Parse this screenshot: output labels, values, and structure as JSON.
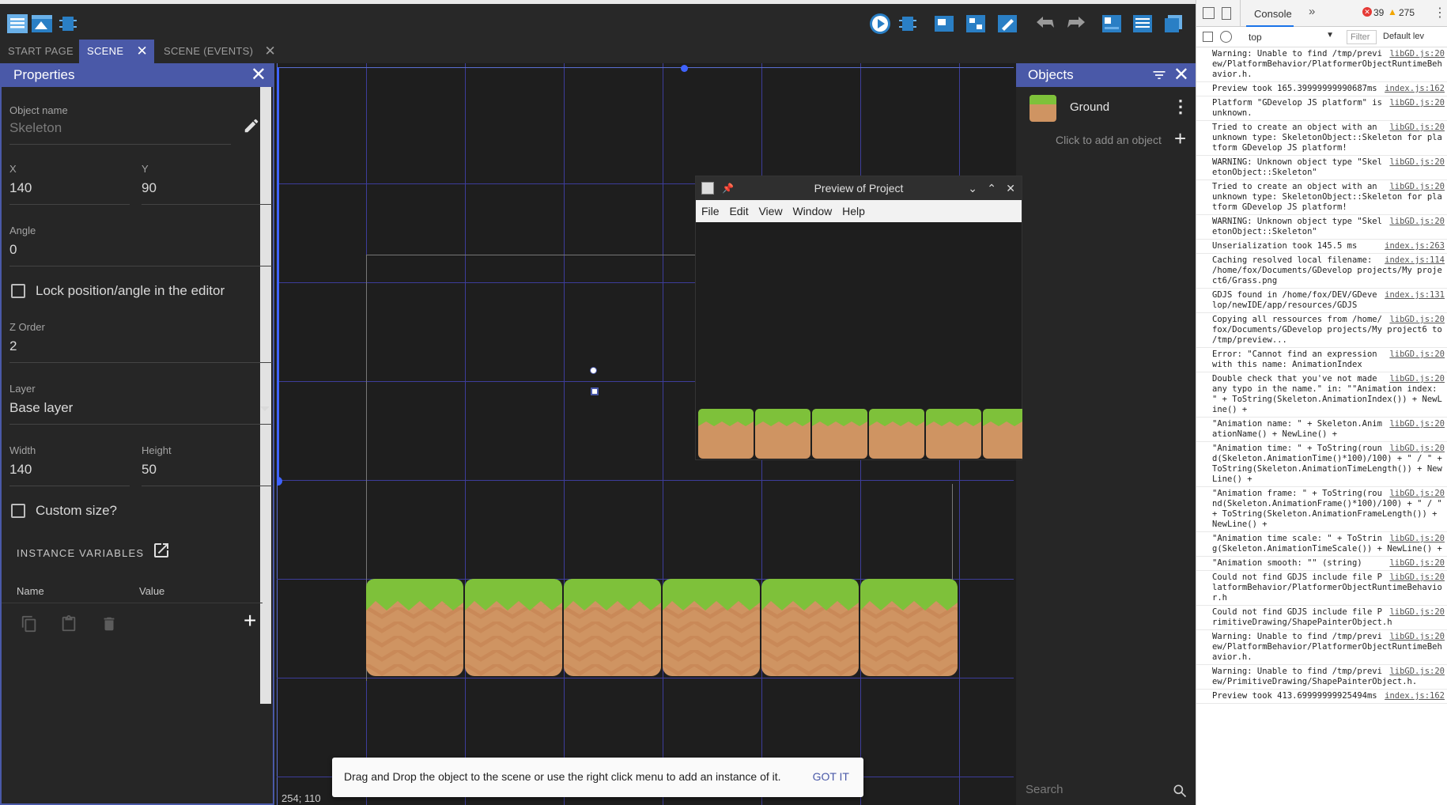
{
  "tabs": [
    {
      "label": "START PAGE"
    },
    {
      "label": "SCENE"
    },
    {
      "label": "SCENE (EVENTS)"
    }
  ],
  "properties": {
    "title": "Properties",
    "object_name_label": "Object name",
    "object_name_value": "Skeleton",
    "x_label": "X",
    "x_value": "140",
    "y_label": "Y",
    "y_value": "90",
    "angle_label": "Angle",
    "angle_value": "0",
    "lock_label": "Lock position/angle in the editor",
    "zorder_label": "Z Order",
    "zorder_value": "2",
    "layer_label": "Layer",
    "layer_value": "Base layer",
    "width_label": "Width",
    "width_value": "140",
    "height_label": "Height",
    "height_value": "50",
    "custom_size_label": "Custom size?",
    "instance_variables_label": "INSTANCE VARIABLES",
    "col_name": "Name",
    "col_value": "Value"
  },
  "scene": {
    "coordinates": "254; 110"
  },
  "objects": {
    "title": "Objects",
    "items": [
      {
        "name": "Ground"
      }
    ],
    "add_object_label": "Click to add an object",
    "search_placeholder": "Search"
  },
  "preview": {
    "title": "Preview of Project",
    "menu": [
      "File",
      "Edit",
      "View",
      "Window",
      "Help"
    ]
  },
  "snackbar": {
    "message": "Drag and Drop the object to the scene or use the right click menu to add an instance of it.",
    "action": "GOT IT"
  },
  "console": {
    "tab_label": "Console",
    "error_count": "39",
    "warning_count": "275",
    "context": "top",
    "filter_placeholder": "Filter",
    "levels_label": "Default lev",
    "entries": [
      {
        "text": "Warning: Unable to find /tmp/preview/PlatformBehavior/PlatformerObjectRuntimeBehavior.h.",
        "src": "libGD.js:20"
      },
      {
        "text": "Preview took 165.39999999990687ms",
        "src": "index.js:162"
      },
      {
        "text": "Platform \"GDevelop JS platform\" is unknown.",
        "src": "libGD.js:20"
      },
      {
        "text": "Tried to create an object with an unknown type: SkeletonObject::Skeleton for platform GDevelop JS platform!",
        "src": "libGD.js:20"
      },
      {
        "text": "WARNING: Unknown object type \"SkeletonObject::Skeleton\"",
        "src": "libGD.js:20"
      },
      {
        "text": "Tried to create an object with an unknown type: SkeletonObject::Skeleton for platform GDevelop JS platform!",
        "src": "libGD.js:20"
      },
      {
        "text": "WARNING: Unknown object type \"SkeletonObject::Skeleton\"",
        "src": "libGD.js:20"
      },
      {
        "text": "Unserialization took 145.5 ms",
        "src": "index.js:263"
      },
      {
        "text": "Caching resolved local filename: /home/fox/Documents/GDevelop projects/My project6/Grass.png",
        "src": "index.js:114"
      },
      {
        "text": "GDJS found in /home/fox/DEV/GDevelop/newIDE/app/resources/GDJS",
        "src": "index.js:131"
      },
      {
        "text": "Copying all ressources from /home/fox/Documents/GDevelop projects/My project6 to /tmp/preview...",
        "src": "libGD.js:20"
      },
      {
        "text": "Error: \"Cannot find an expression with this name: AnimationIndex",
        "src": "libGD.js:20"
      },
      {
        "text": "Double check that you've not made any typo in the name.\" in: \"\"Animation index: \" + ToString(Skeleton.AnimationIndex()) + NewLine() +",
        "src": "libGD.js:20"
      },
      {
        "text": "\"Animation name: \" + Skeleton.AnimationName() + NewLine() +",
        "src": "libGD.js:20"
      },
      {
        "text": "\"Animation time: \" + ToString(round(Skeleton.AnimationTime()*100)/100) + \" / \" + ToString(Skeleton.AnimationTimeLength()) + NewLine() +",
        "src": "libGD.js:20"
      },
      {
        "text": "\"Animation frame: \" + ToString(round(Skeleton.AnimationFrame()*100)/100) + \" / \" + ToString(Skeleton.AnimationFrameLength()) + NewLine() +",
        "src": "libGD.js:20"
      },
      {
        "text": "\"Animation time scale: \" + ToString(Skeleton.AnimationTimeScale()) + NewLine() +",
        "src": "libGD.js:20"
      },
      {
        "text": "\"Animation smooth: \"\" (string)",
        "src": "libGD.js:20"
      },
      {
        "text": "Could not find GDJS include file PlatformBehavior/PlatformerObjectRuntimeBehavior.h",
        "src": "libGD.js:20"
      },
      {
        "text": "Could not find GDJS include file PrimitiveDrawing/ShapePainterObject.h",
        "src": "libGD.js:20"
      },
      {
        "text": "Warning: Unable to find /tmp/preview/PlatformBehavior/PlatformerObjectRuntimeBehavior.h.",
        "src": "libGD.js:20"
      },
      {
        "text": "Warning: Unable to find /tmp/preview/PrimitiveDrawing/ShapePainterObject.h.",
        "src": "libGD.js:20"
      },
      {
        "text": "Preview took 413.69999999925494ms",
        "src": "index.js:162"
      }
    ]
  }
}
